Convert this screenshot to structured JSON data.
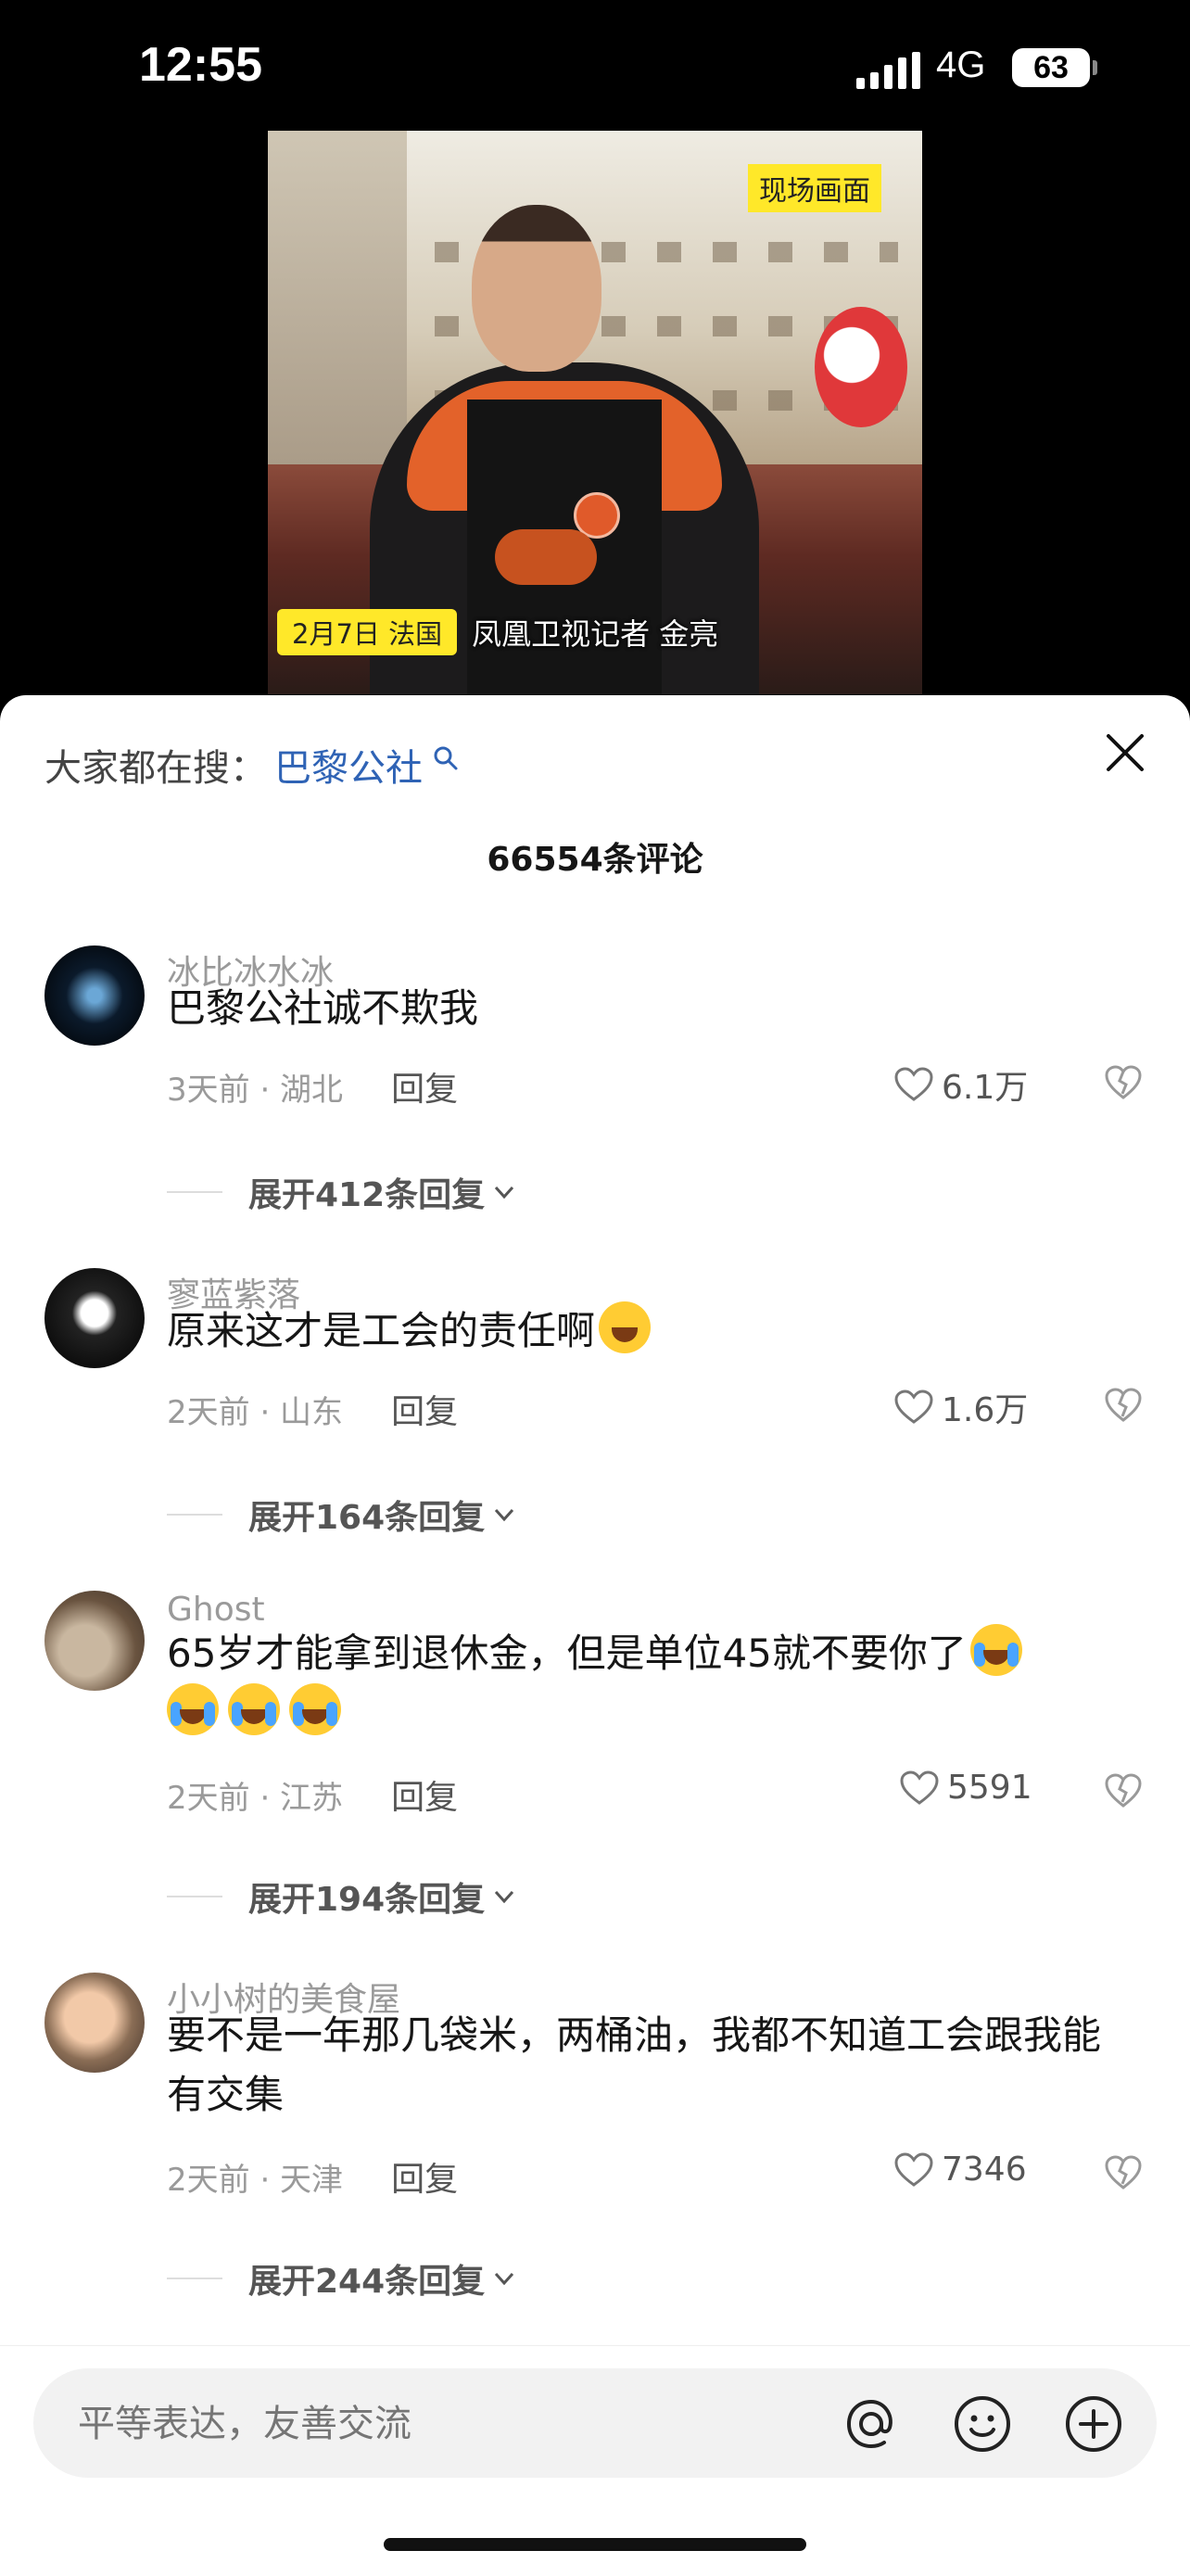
{
  "status_bar": {
    "time": "12:55",
    "network": "4G",
    "battery": "63"
  },
  "video": {
    "live_tag": "现场画面",
    "date_tag": "2月7日 法国",
    "reporter": "凤凰卫视记者 金亮"
  },
  "search": {
    "label": "大家都在搜：",
    "term": "巴黎公社"
  },
  "comment_count": "66554条评论",
  "comments": [
    {
      "user": "冰比冰水冰",
      "text": "巴黎公社诚不欺我",
      "meta": "3天前 · 湖北",
      "reply": "回复",
      "likes": "6.1万",
      "expand": "展开412条回复"
    },
    {
      "user": "寥蓝紫落",
      "text": "原来这才是工会的责任啊",
      "meta": "2天前 · 山东",
      "reply": "回复",
      "likes": "1.6万",
      "expand": "展开164条回复"
    },
    {
      "user": "Ghost",
      "text": "65岁才能拿到退休金，但是单位45就不要你了",
      "meta": "2天前 · 江苏",
      "reply": "回复",
      "likes": "5591",
      "expand": "展开194条回复"
    },
    {
      "user": "小小树的美食屋",
      "text": "要不是一年那几袋米，两桶油，我都不知道工会跟我能有交集",
      "meta": "2天前 · 天津",
      "reply": "回复",
      "likes": "7346",
      "expand": "展开244条回复"
    }
  ],
  "input": {
    "placeholder": "平等表达，友善交流"
  },
  "icons": [
    "search-icon",
    "close-icon",
    "heart-icon",
    "dislike-icon",
    "chevron-down-icon",
    "at-icon",
    "emoji-icon",
    "plus-icon"
  ]
}
